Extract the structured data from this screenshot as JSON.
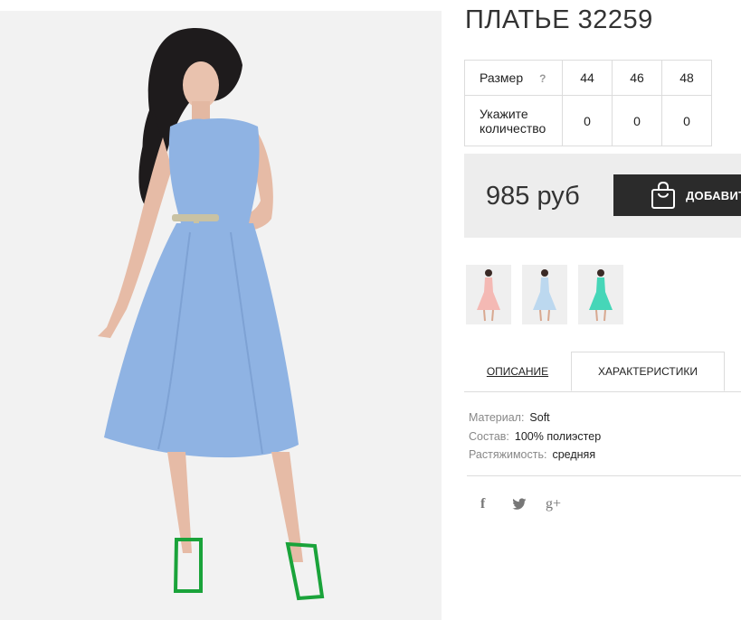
{
  "product": {
    "title": "ПЛАТЬЕ 32259"
  },
  "size_table": {
    "size_label": "Размер",
    "help_glyph": "?",
    "sizes": [
      "44",
      "46",
      "48"
    ],
    "quantity_label_line1": "Укажите",
    "quantity_label_line2": "количество",
    "quantities": [
      "0",
      "0",
      "0"
    ]
  },
  "buy": {
    "price": "985 руб",
    "cart_label": "ДОБАВИТЬ"
  },
  "thumbnails": [
    {
      "color": "#f4b9b4",
      "icon": "dress-pink"
    },
    {
      "color": "#bcd8ef",
      "icon": "dress-blue"
    },
    {
      "color": "#46d6b8",
      "icon": "dress-mint"
    }
  ],
  "tabs": {
    "description": "ОПИСАНИЕ",
    "characteristics": "ХАРАКТЕРИСТИКИ"
  },
  "specs": [
    {
      "key": "Материал:",
      "value": "Soft"
    },
    {
      "key": "Состав:",
      "value": "100% полиэстер"
    },
    {
      "key": "Растяжимость:",
      "value": "средняя"
    }
  ],
  "social": {
    "facebook": "f",
    "twitter": "🐦",
    "google_plus": "g+"
  },
  "colors": {
    "dress": "#8fb3e3",
    "button_bg": "#2b2b2b",
    "panel_bg": "#ededed",
    "shoes": "#1aa33a"
  }
}
